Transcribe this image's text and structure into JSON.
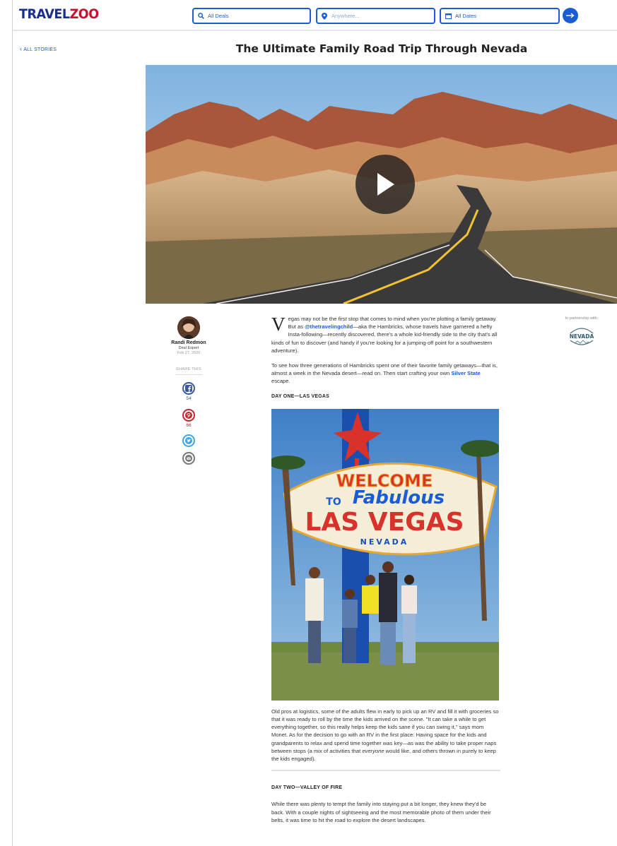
{
  "header": {
    "logo_main": "TRAVEL",
    "logo_accent": "ZOO",
    "deals_value": "All Deals",
    "where_placeholder": "Anywhere...",
    "dates_value": "All Dates"
  },
  "nav": {
    "back_label": "ALL STORIES"
  },
  "article": {
    "title": "The Ultimate Family Road Trip Through Nevada",
    "dropcap": "V",
    "p1_a": "egas may not be the ",
    "p1_em": "first",
    "p1_b": " stop that comes to mind when you're plotting a family getaway. But as ",
    "p1_link": "@thetravelingchild",
    "p1_c": "—aka the Hambricks, whose travels have garnered a hefty Insta-following—recently discovered, there's a whole kid-friendly side to the city that's all kinds of fun to discover (and handy if you're looking for a jumping-off point for a southwestern adventure).",
    "p2_a": "To see how three generations of Hambricks spent one of their favorite family getaways—that is, almost a week in the Nevada desert—read on. Then start crafting your own ",
    "p2_link": "Silver State",
    "p2_b": " escape.",
    "day1_heading": "DAY ONE—LAS VEGAS",
    "sign_welcome": "WELCOME",
    "sign_to": "TO",
    "sign_fabulous": "Fabulous",
    "sign_city": "LAS VEGAS",
    "sign_state": "NEVADA",
    "p3_a": "Old pros at logistics, some of the adults flew in early to pick up an RV and fill it with groceries so that it was ready to roll by the time the kids arrived on the scene. \"It can take a while to get everything together, so this really helps keep the kids sane if you can swing it,\" says mom Monet. As for the decision to go with an RV in the first place: Having space for the kids and grandparents to relax and spend time together was key—as was the ability to take proper naps between stops (a mix of activities that ",
    "p3_em": "everyone",
    "p3_b": " would like, and others thrown in purely to keep the kids engaged).",
    "day2_heading": "DAY TWO—VALLEY OF FIRE",
    "p4": "While there was plenty to tempt the family into staying put a bit longer, they knew they'd be back. With a couple nights of sightseeing and the most memorable photo of them under their belts, it was time to hit the road to explore the desert landscapes."
  },
  "author": {
    "name": "Randi Redmon",
    "role": "Deal Expert",
    "date": "Feb 27, 2020"
  },
  "share": {
    "label": "SHARE THIS",
    "facebook_count": "54",
    "pinterest_count": "66"
  },
  "partner": {
    "label": "In partnership with:",
    "logo_text": "NEVADA"
  },
  "colors": {
    "brand_blue": "#1a5bd6",
    "logo_navy": "#1a2f8a",
    "logo_red": "#c8102e",
    "facebook": "#3b5a9a",
    "pinterest": "#c8232c",
    "twitter": "#3da5e8",
    "email": "#777777"
  },
  "icons": [
    "search-icon",
    "location-pin-icon",
    "calendar-icon",
    "arrow-right-icon",
    "play-icon",
    "facebook-icon",
    "pinterest-icon",
    "twitter-icon",
    "email-icon",
    "chevron-left-icon"
  ]
}
